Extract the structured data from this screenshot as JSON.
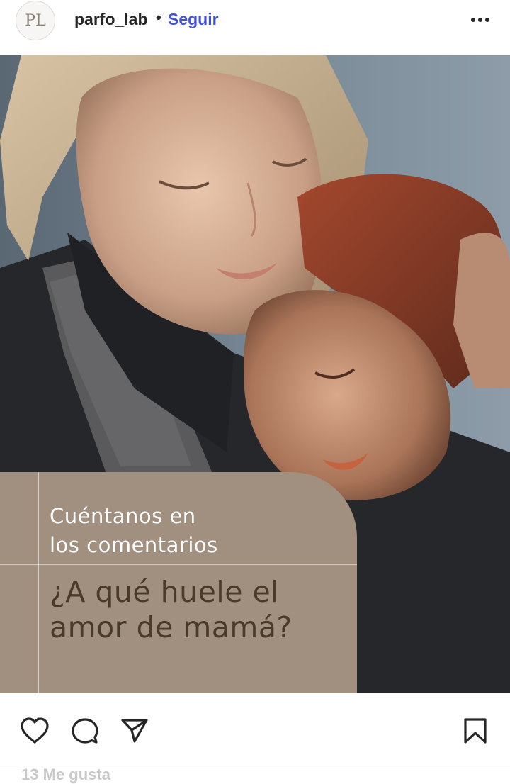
{
  "post": {
    "username": "parfo_lab",
    "separator": "•",
    "follow_label": "Seguir",
    "avatar_monogram": "PL"
  },
  "card": {
    "subtitle_line1": "Cuéntanos en",
    "subtitle_line2": "los comentarios",
    "title_line1": "¿A qué huele el",
    "title_line2": "amor de mamá?"
  },
  "footer": {
    "likes_text": "13 Me gusta"
  },
  "icons": {
    "more": "more-horizontal-icon",
    "like": "heart-icon",
    "comment": "comment-bubble-icon",
    "share": "send-paper-plane-icon",
    "save": "bookmark-icon"
  },
  "colors": {
    "follow_blue": "#4150d8",
    "card_taupe": "#a1907f",
    "card_title_brown": "#4a3a2c"
  }
}
